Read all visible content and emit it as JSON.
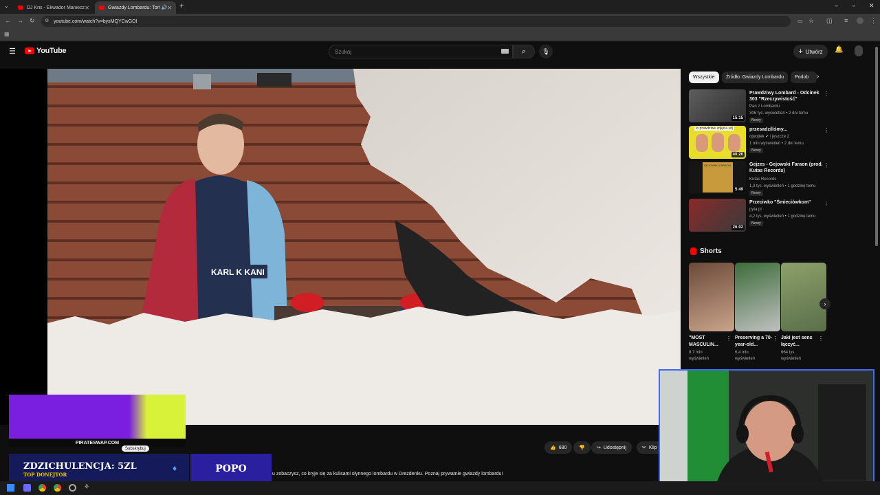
{
  "browser": {
    "tabs": [
      {
        "title": "DJ Kris - Ekwador Manieczki | R",
        "active": false
      },
      {
        "title": "Gwiazdy Lombardu: Tortili",
        "active": true
      }
    ],
    "url": "youtube.com/watch?v=bysMQYCwGOI"
  },
  "youtube": {
    "logo_text": "YouTube",
    "search_placeholder": "Szukaj",
    "create_label": "Utwórz"
  },
  "video": {
    "shirt_text": "KARL K KANI",
    "like_count": "680",
    "share_label": "Udostępnij",
    "clip_label": "Klip",
    "subscribe_label": "Subskrybuj",
    "description_line": "u zobaczysz, co kryje się za kulisami słynnego lombardu w Drezdenku. Poznaj prywatnie gwiazdy lombardu!"
  },
  "sidebar": {
    "chips": [
      "Wszystkie",
      "Źródło: Gwiazdy Lombardu",
      "Podob"
    ],
    "recommendations": [
      {
        "title": "Prawdziwy Lombard - Odcinek 303 \"Rzeczywistość\"",
        "channel": "Pan z Lombardu",
        "stats": "306 tys. wyświetleń • 2 dni temu",
        "badge": "Nowy",
        "duration": "15:15"
      },
      {
        "title": "przesadziliśmy...",
        "channel": "ojwojtek",
        "channel_extra": "i jeszcze 2",
        "stats": "1 mln wyświetleń • 2 dni temu",
        "badge": "Nowy",
        "duration": "40:20",
        "thumb_text": "to prawdziwe zdjęcia sdj"
      },
      {
        "title": "Gejzes - Gejowski Faraon (prod. Kutas Records)",
        "channel": "Kutas Records",
        "stats": "1,3 tys. wyświetleń • 1 godzinę temu",
        "badge": "Nowy",
        "duration": "5:49",
        "thumb_text": "GEJOWSKI FARAON"
      },
      {
        "title": "Przeciwko \"Śmieciówkom\"",
        "channel": "pyta.pl",
        "stats": "4,2 tys. wyświetleń • 1 godzinę temu",
        "badge": "Nowy",
        "duration": "26:02"
      }
    ],
    "shorts_heading": "Shorts",
    "shorts": [
      {
        "title": "\"MOST MASCULIN...",
        "views": "8,7 mln",
        "views_label": "wyświetleń"
      },
      {
        "title": "Preserving a 70-year-old...",
        "views": "6,4 mln",
        "views_label": "wyświetleń"
      },
      {
        "title": "Jaki jest sens łączyć...",
        "views": "664 tys.",
        "views_label": "wyświetleń"
      }
    ]
  },
  "overlay": {
    "promo_site": "PIRATESWAP.COM",
    "donation_text": "ZDZICHULENCJA: 5ZL",
    "donation_sub": "TOP DONEJTOR",
    "donation_name": "POPO"
  },
  "colors": {
    "yt_red": "#ff0000",
    "bg": "#0f0f0f",
    "webcam_border": "#3b6df5",
    "promo_purple": "#7a1fe0",
    "promo_yellow": "#d7f238",
    "donate_navy": "#141a5a"
  }
}
